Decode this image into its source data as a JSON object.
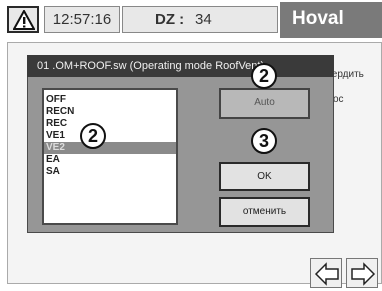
{
  "header": {
    "time": "12:57:16",
    "dz_label": "DZ :",
    "dz_value": "34",
    "brand": "Hoval",
    "warning_icon": "warning-icon"
  },
  "background": {
    "text1": "твердить",
    "text2": "ос"
  },
  "dialog": {
    "title": "01   .OM+ROOF.sw (Operating mode RoofVent)",
    "list_items": [
      "OFF",
      "RECN",
      "REC",
      "VE1",
      "VE2",
      "EA",
      "SA"
    ],
    "selected_item": "VE2",
    "buttons": {
      "auto": "Auto",
      "ok": "OK",
      "cancel": "отменить"
    },
    "callouts": {
      "auto": "2",
      "list": "2",
      "ok": "3"
    }
  },
  "nav": {
    "back_icon": "arrow-left-icon",
    "forward_icon": "arrow-right-icon"
  }
}
